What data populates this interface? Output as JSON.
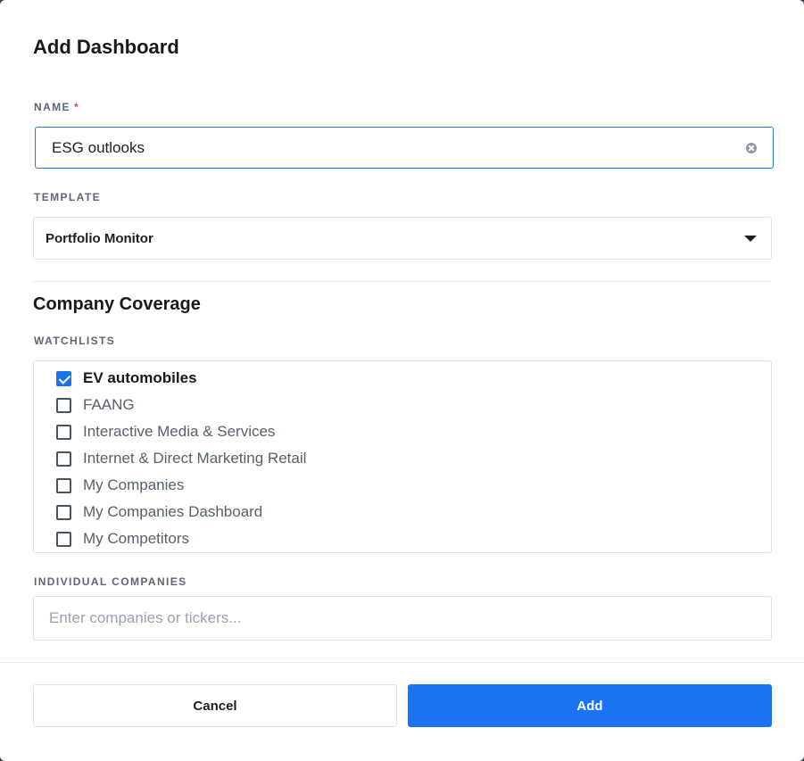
{
  "dialog": {
    "title": "Add Dashboard"
  },
  "name_field": {
    "label": "NAME",
    "required_marker": "*",
    "value": "ESG outlooks",
    "clear_icon": "clear-circle-icon"
  },
  "template_field": {
    "label": "TEMPLATE",
    "selected": "Portfolio Monitor",
    "caret_icon": "caret-down-icon"
  },
  "coverage": {
    "title": "Company Coverage",
    "watchlists_label": "WATCHLISTS",
    "watchlists": [
      {
        "label": "EV automobiles",
        "checked": true
      },
      {
        "label": "FAANG",
        "checked": false
      },
      {
        "label": "Interactive Media & Services",
        "checked": false
      },
      {
        "label": "Internet & Direct Marketing Retail",
        "checked": false
      },
      {
        "label": "My Companies",
        "checked": false
      },
      {
        "label": "My Companies Dashboard",
        "checked": false
      },
      {
        "label": "My Competitors",
        "checked": false
      }
    ],
    "individual_label": "INDIVIDUAL COMPANIES",
    "individual_placeholder": "Enter companies or tickers..."
  },
  "footer": {
    "cancel_label": "Cancel",
    "add_label": "Add"
  },
  "colors": {
    "primary": "#1a73f0",
    "focus_border": "#2b7bd6",
    "required": "#e5484d"
  }
}
